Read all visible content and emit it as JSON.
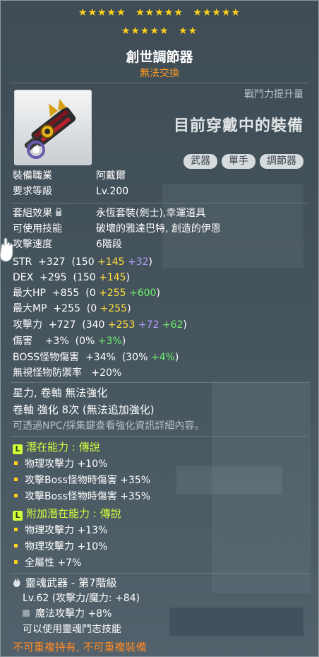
{
  "stars": {
    "row1": [
      "★★★★★",
      "★★★★★",
      "★★★★★"
    ],
    "row2": [
      "★★★★★",
      "★★"
    ]
  },
  "item": {
    "name": "創世調節器",
    "trade": "無法交換"
  },
  "header": {
    "power_gain": "戰鬥力提升量",
    "equipped": "目前穿戴中的裝備",
    "chips": [
      "武器",
      "單手",
      "調節器"
    ]
  },
  "info": {
    "job_label": "裝備職業",
    "job_value": "阿戴爾",
    "level_label": "要求等級",
    "level_value": "Lv.200",
    "set_label": "套組效果",
    "set_value": "永恆套裝(劍士),幸運道具",
    "skill_label": "可使用技能",
    "skill_value": "破壞的雅達巴特, 創造的伊恩",
    "speed_label": "攻擊速度",
    "speed_value": "6階段"
  },
  "stats": {
    "str": {
      "label": "STR",
      "total": "+327",
      "base": "(150",
      "a": "+145",
      "b": "+32",
      "close": ")"
    },
    "dex": {
      "label": "DEX",
      "total": "+295",
      "base": "(150",
      "a": "+145",
      "close": ")"
    },
    "hp": {
      "label": "最大HP",
      "total": "+855",
      "base": "(0",
      "a": "+255",
      "b": "+600",
      "close": ")"
    },
    "mp": {
      "label": "最大MP",
      "total": "+255",
      "base": "(0",
      "a": "+255",
      "close": ")"
    },
    "atk": {
      "label": "攻擊力",
      "total": "+727",
      "base": "(340",
      "a": "+253",
      "b": "+72",
      "c": "+62",
      "close": ")"
    },
    "dmg": {
      "label": "傷害",
      "total": "+3%",
      "base": "(0%",
      "a": "+3%",
      "close": ")"
    },
    "boss": {
      "label": "BOSS怪物傷害",
      "total": "+34%",
      "base": "(30%",
      "a": "+4%",
      "close": ")"
    },
    "ied": {
      "label": "無視怪物防禦率",
      "total": "+20%"
    }
  },
  "enhance": {
    "line1": "星力, 卷軸 無法強化",
    "line2": "卷軸 強化 8次 (無法追加強化)",
    "line3": "可透過NPC/採集鍵查看強化資訊詳細內容。"
  },
  "potential": {
    "title": "潛在能力 : 傳說",
    "badge": "L",
    "lines": [
      "物理攻擊力 +10%",
      "攻擊Boss怪物時傷害 +35%",
      "攻擊Boss怪物時傷害 +35%"
    ]
  },
  "additional": {
    "title": "附加潛在能力 : 傳說",
    "badge": "L",
    "lines": [
      "物理攻擊力 +13%",
      "物理攻擊力 +10%",
      "全屬性 +7%"
    ]
  },
  "soul": {
    "title": "靈魂武器 - 第7階級",
    "level": "Lv.62 (攻擊力/魔力: +84)",
    "option": "魔法攻擊力 +8%",
    "skill": "可以使用靈魂鬥志技能"
  },
  "footer": "不可重複持有, 不可重複裝備",
  "colors": {
    "gold": "#ffde3a",
    "purple": "#b49cff",
    "green": "#6df06d",
    "section": "#d4ff3c",
    "orange": "#ff8a25"
  }
}
